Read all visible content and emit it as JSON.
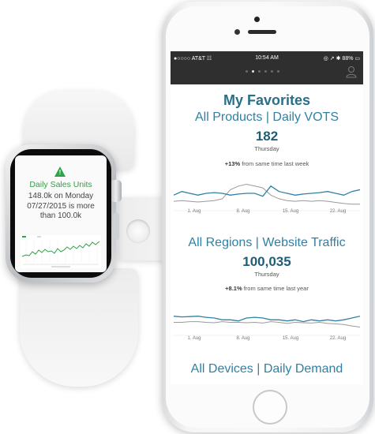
{
  "watch": {
    "alert_title": "Daily Sales Units",
    "message_lines": [
      "148.0k on Monday",
      "07/27/2015  is more",
      "than 100.0k"
    ],
    "alert_icon": "warning-triangle-icon",
    "alert_mark": "!",
    "accent": "#2ea34a"
  },
  "phone": {
    "status": {
      "carrier": "●○○○○ AT&T ☷",
      "time": "10:54 AM",
      "right": "◎ ↗ ✱ 88% ▭"
    },
    "page_indicator": {
      "count": 6,
      "active_index": 1
    },
    "header_title": "My Favorites",
    "cards": [
      {
        "title": "All Products | Daily VOTS",
        "value": "182",
        "day": "Thursday",
        "delta_bold": "+13%",
        "delta_text": " from same time last week",
        "x_ticks": [
          "1. Aug",
          "8. Aug",
          "15. Aug",
          "22. Aug"
        ],
        "primary": [
          0.55,
          0.45,
          0.5,
          0.55,
          0.5,
          0.48,
          0.5,
          0.55,
          0.52,
          0.5,
          0.5,
          0.58,
          0.3,
          0.45,
          0.5,
          0.55,
          0.52,
          0.5,
          0.48,
          0.45,
          0.5,
          0.55,
          0.45,
          0.4
        ],
        "secondary": [
          0.72,
          0.7,
          0.72,
          0.74,
          0.72,
          0.7,
          0.65,
          0.4,
          0.3,
          0.25,
          0.3,
          0.35,
          0.55,
          0.65,
          0.7,
          0.72,
          0.7,
          0.72,
          0.7,
          0.72,
          0.75,
          0.78,
          0.8,
          0.8
        ]
      },
      {
        "title": "All Regions | Website Traffic",
        "value": "100,035",
        "day": "Thursday",
        "delta_bold": "+8.1%",
        "delta_text": " from same time last year",
        "x_ticks": [
          "1. Aug",
          "8. Aug",
          "15. Aug",
          "22. Aug"
        ],
        "primary": [
          0.45,
          0.47,
          0.46,
          0.45,
          0.48,
          0.5,
          0.55,
          0.55,
          0.58,
          0.5,
          0.48,
          0.5,
          0.55,
          0.55,
          0.58,
          0.55,
          0.6,
          0.55,
          0.58,
          0.55,
          0.58,
          0.55,
          0.5,
          0.45
        ],
        "secondary": [
          0.62,
          0.62,
          0.6,
          0.6,
          0.62,
          0.63,
          0.6,
          0.62,
          0.62,
          0.63,
          0.62,
          0.64,
          0.6,
          0.62,
          0.65,
          0.62,
          0.63,
          0.64,
          0.62,
          0.65,
          0.66,
          0.68,
          0.72,
          0.75
        ]
      },
      {
        "title": "All Devices | Daily Demand"
      }
    ],
    "colors": {
      "line_primary": "#2f81a5",
      "line_secondary": "#9a9a9a"
    }
  }
}
